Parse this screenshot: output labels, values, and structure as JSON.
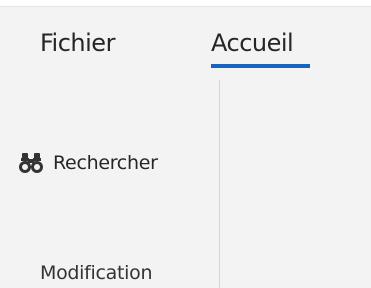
{
  "ribbon": {
    "tabs": [
      {
        "label": "Fichier",
        "active": false
      },
      {
        "label": "Accueil",
        "active": true
      }
    ],
    "accent_color": "#1565c0"
  },
  "find_group": {
    "find_button": {
      "label": "Rechercher",
      "icon": "binoculars-icon"
    },
    "group_label": "Modification"
  }
}
